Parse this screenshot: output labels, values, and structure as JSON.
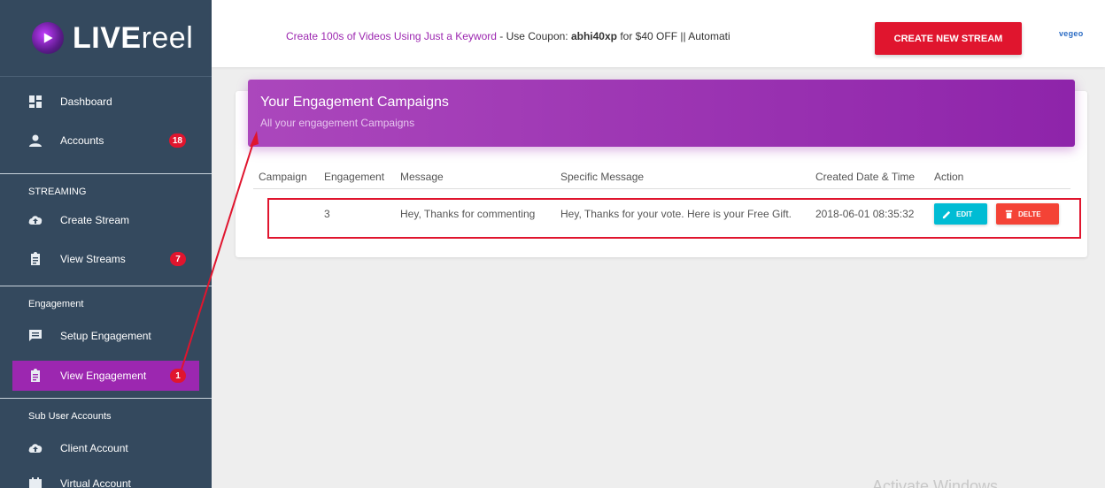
{
  "brand": {
    "bold": "LIVE",
    "light": "reel"
  },
  "sidebar": {
    "main_items": [
      {
        "label": "Dashboard",
        "icon": "dashboard-icon"
      },
      {
        "label": "Accounts",
        "icon": "person-icon",
        "badge": "18"
      }
    ],
    "streaming": {
      "title": "STREAMING",
      "items": [
        {
          "label": "Create Stream",
          "icon": "cloud-upload-icon"
        },
        {
          "label": "View Streams",
          "icon": "clipboard-icon",
          "badge": "7"
        }
      ]
    },
    "engagement": {
      "title": "Engagement",
      "items": [
        {
          "label": "Setup Engagement",
          "icon": "message-icon"
        },
        {
          "label": "View Engagement",
          "icon": "clipboard-icon",
          "badge": "1"
        }
      ]
    },
    "sub_users": {
      "title": "Sub User Accounts",
      "items": [
        {
          "label": "Client Account",
          "icon": "cloud-upload-icon"
        },
        {
          "label": "Virtual Account",
          "icon": "calendar-icon"
        }
      ]
    }
  },
  "topbar": {
    "promo_lead": "Create 100s of Videos Using Just a Keyword",
    "promo_coupon_text": " - Use Coupon: ",
    "promo_code": "abhi40xp",
    "promo_rest": " for $40 OFF || Automati",
    "create_button": "CREATE NEW STREAM",
    "partner_logo": "vegeo"
  },
  "card": {
    "title": "Your Engagement Campaigns",
    "subtitle": "All your engagement Campaigns",
    "columns": [
      "Campaign",
      "Engagement",
      "Message",
      "Specific Message",
      "Created Date & Time",
      "Action"
    ],
    "rows": [
      {
        "campaign": "",
        "engagement": "3",
        "message": "Hey, Thanks for commenting",
        "specific_message": "Hey, Thanks for your vote. Here is your Free Gift.",
        "created": "2018-06-01 08:35:32",
        "edit_label": "EDIT",
        "delete_label": "DELTE"
      }
    ]
  },
  "watermark": "Activate Windows",
  "colors": {
    "sidebar": "#34495e",
    "accent": "#9c27b0",
    "danger": "#e0152e",
    "info": "#00bcd4"
  }
}
